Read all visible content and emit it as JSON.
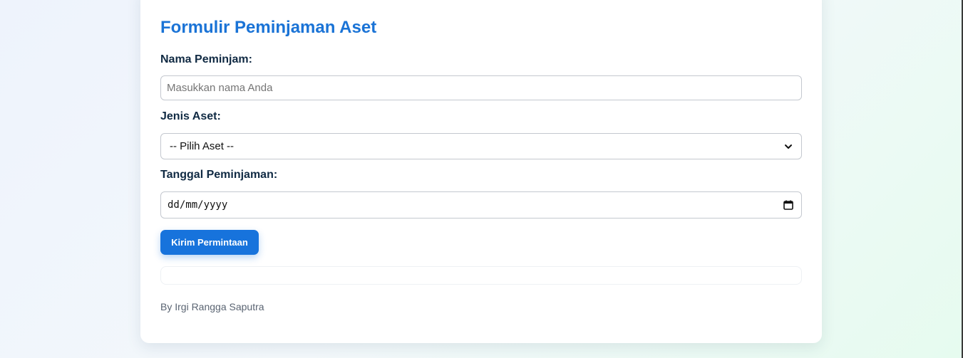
{
  "form": {
    "title": "Formulir Peminjaman Aset",
    "name_label": "Nama Peminjam:",
    "name_placeholder": "Masukkan nama Anda",
    "asset_label": "Jenis Aset:",
    "asset_selected": "-- Pilih Aset --",
    "date_label": "Tanggal Peminjaman:",
    "date_placeholder": "dd/mm/yyyy",
    "submit_label": "Kirim Permintaan"
  },
  "footer": {
    "credit": "By Irgi Rangga Saputra"
  },
  "colors": {
    "accent": "#1773dc",
    "title": "#1a73d6"
  },
  "icons": {
    "select": "chevron-down-icon",
    "date": "calendar-icon"
  }
}
